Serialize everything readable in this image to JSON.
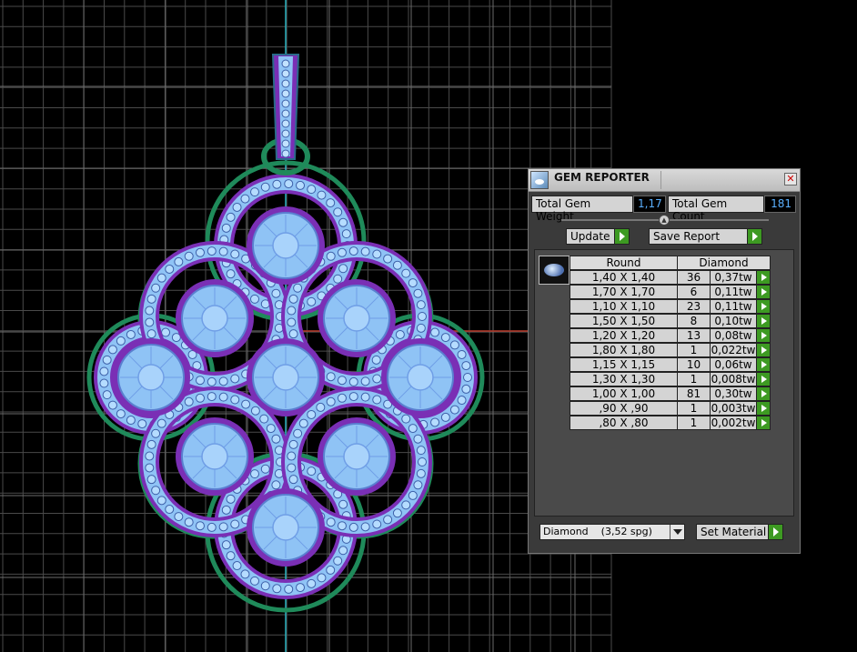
{
  "panel": {
    "title": "GEM REPORTER",
    "close_glyph": "✕",
    "total_weight_label": "Total Gem Weight",
    "total_weight_value": "1,17",
    "total_count_label": "Total Gem Count",
    "total_count_value": "181",
    "update_label": "Update",
    "save_report_label": "Save Report",
    "shape_header": "Round",
    "material_header": "Diamond",
    "material_select": "Diamond    (3,52 spg)",
    "set_material_label": "Set Material"
  },
  "gems": [
    {
      "size": "1,40 X 1,40",
      "count": "36",
      "weight": "0,37tw"
    },
    {
      "size": "1,70 X 1,70",
      "count": "6",
      "weight": "0,11tw"
    },
    {
      "size": "1,10 X 1,10",
      "count": "23",
      "weight": "0,11tw"
    },
    {
      "size": "1,50 X 1,50",
      "count": "8",
      "weight": "0,10tw"
    },
    {
      "size": "1,20 X 1,20",
      "count": "13",
      "weight": "0,08tw"
    },
    {
      "size": "1,80 X 1,80",
      "count": "1",
      "weight": "0,022tw"
    },
    {
      "size": "1,15 X 1,15",
      "count": "10",
      "weight": "0,06tw"
    },
    {
      "size": "1,30 X 1,30",
      "count": "1",
      "weight": "0,008tw"
    },
    {
      "size": "1,00 X 1,00",
      "count": "81",
      "weight": "0,30tw"
    },
    {
      "size": ",90 X ,90",
      "count": "1",
      "weight": "0,003tw"
    },
    {
      "size": ",80 X ,80",
      "count": "1",
      "weight": "0,002tw"
    }
  ],
  "colors": {
    "background": "#000000",
    "grid": "#4a4a4a",
    "gem_blue": "#8fc3f5",
    "prong_purple": "#7a2fb5",
    "metal_green": "#1f8a5a",
    "accent_green_button": "#3d9a22",
    "value_text": "#5ab0ff"
  }
}
